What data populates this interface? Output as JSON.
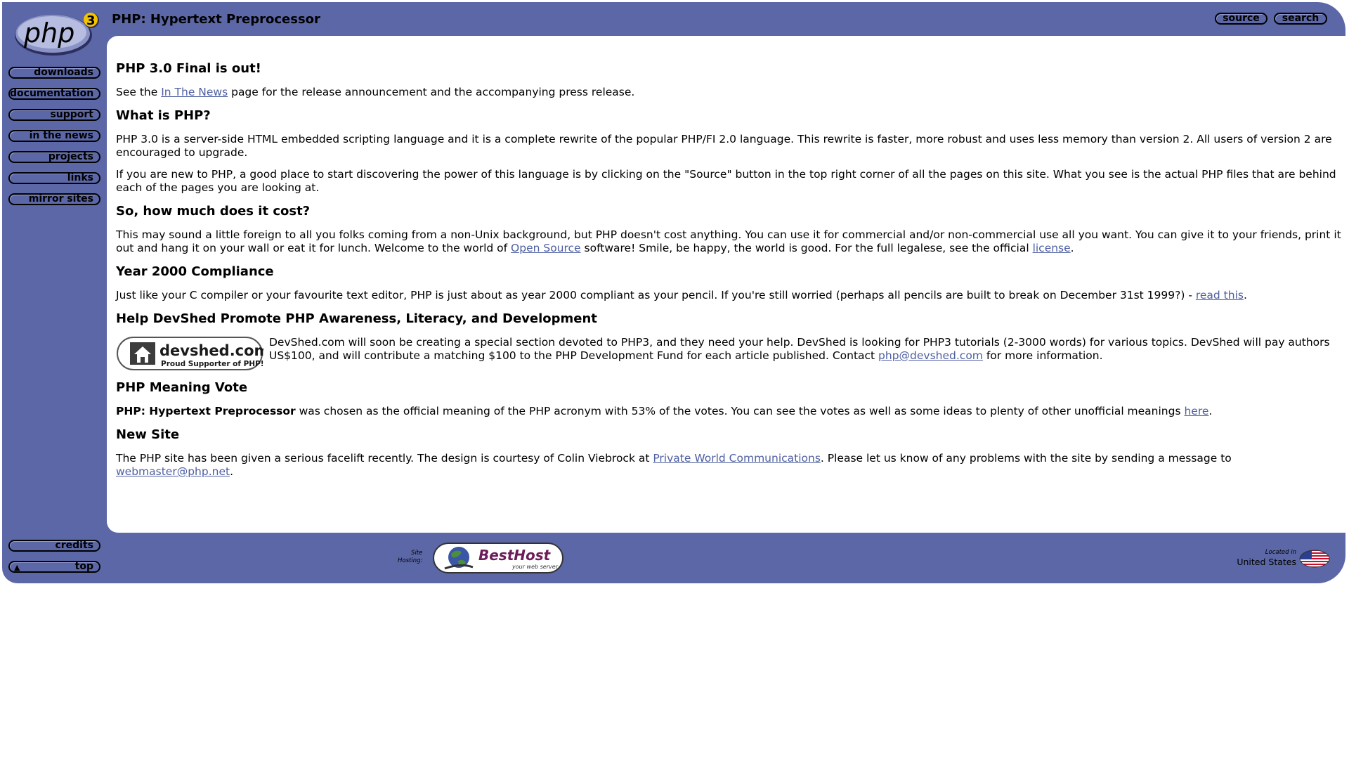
{
  "header": {
    "title": "PHP: Hypertext Preprocessor",
    "logo_text": "php",
    "logo_version": "3",
    "source_label": "source",
    "search_label": "search"
  },
  "sidebar": {
    "items": [
      {
        "label": "downloads"
      },
      {
        "label": "documentation"
      },
      {
        "label": "support"
      },
      {
        "label": "in the news"
      },
      {
        "label": "projects"
      },
      {
        "label": "links"
      },
      {
        "label": "mirror sites"
      }
    ],
    "credits_label": "credits",
    "top_label": "top",
    "top_arrow": "▲"
  },
  "main": {
    "s1": {
      "heading": "PHP 3.0 Final is out!",
      "p1_before": "See the ",
      "p1_link": "In The News",
      "p1_after": " page for the release announcement and the accompanying press release."
    },
    "s2": {
      "heading": "What is PHP?",
      "p1": "PHP 3.0 is a server-side HTML embedded scripting language and it is a complete rewrite of the popular PHP/FI 2.0 language. This rewrite is faster, more robust and uses less memory than version 2. All users of version 2 are encouraged to upgrade.",
      "p2": "If you are new to PHP, a good place to start discovering the power of this language is by clicking on the \"Source\" button in the top right corner of all the pages on this site. What you see is the actual PHP files that are behind each of the pages you are looking at."
    },
    "s3": {
      "heading": "So, how much does it cost?",
      "p1_before": "This may sound a little foreign to all you folks coming from a non-Unix background, but PHP doesn't cost anything. You can use it for commercial and/or non-commercial use all you want. You can give it to your friends, print it out and hang it on your wall or eat it for lunch. Welcome to the world of ",
      "p1_link1": "Open Source",
      "p1_mid": " software! Smile, be happy, the world is good. For the full legalese, see the official ",
      "p1_link2": "license",
      "p1_after": "."
    },
    "s4": {
      "heading": "Year 2000 Compliance",
      "p1_before": "Just like your C compiler or your favourite text editor, PHP is just about as year 2000 compliant as your pencil. If you're still worried (perhaps all pencils are built to break on December 31st 1999?) - ",
      "p1_link": "read this",
      "p1_after": "."
    },
    "s5": {
      "heading": "Help DevShed Promote PHP Awareness, Literacy, and Development",
      "logo_name": "devshed.com",
      "logo_tagline": "Proud Supporter of PHP!",
      "p1_before": "DevShed.com will soon be creating a special section devoted to PHP3, and they need your help. DevShed is looking for PHP3 tutorials (2-3000 words) for various topics. DevShed will pay authors US$100, and will contribute a matching $100 to the PHP Development Fund for each article published. Contact ",
      "p1_link": "php@devshed.com",
      "p1_after": " for more information."
    },
    "s6": {
      "heading": "PHP Meaning Vote",
      "p1_bold": "PHP: Hypertext Preprocessor",
      "p1_before": " was chosen as the official meaning of the PHP acronym with 53% of the votes. You can see the votes as well as some ideas to plenty of other unofficial meanings ",
      "p1_link": "here",
      "p1_after": "."
    },
    "s7": {
      "heading": "New Site",
      "p1_before": "The PHP site has been given a serious facelift recently. The design is courtesy of Colin Viebrock at ",
      "p1_link1": "Private World Communications",
      "p1_mid": ". Please let us know of any problems with the site by sending a message to ",
      "p1_link2": "webmaster@php.net",
      "p1_after": "."
    }
  },
  "footer": {
    "hosting_label_line1": "Site",
    "hosting_label_line2": "Hosting:",
    "besthost_name": "BestHost",
    "besthost_tagline": "your web server",
    "located_label": "Located in",
    "located_country": "United States"
  },
  "colors": {
    "frame": "#5b67a6",
    "link": "#4e5fa1",
    "content_bg": "#ffffff"
  }
}
